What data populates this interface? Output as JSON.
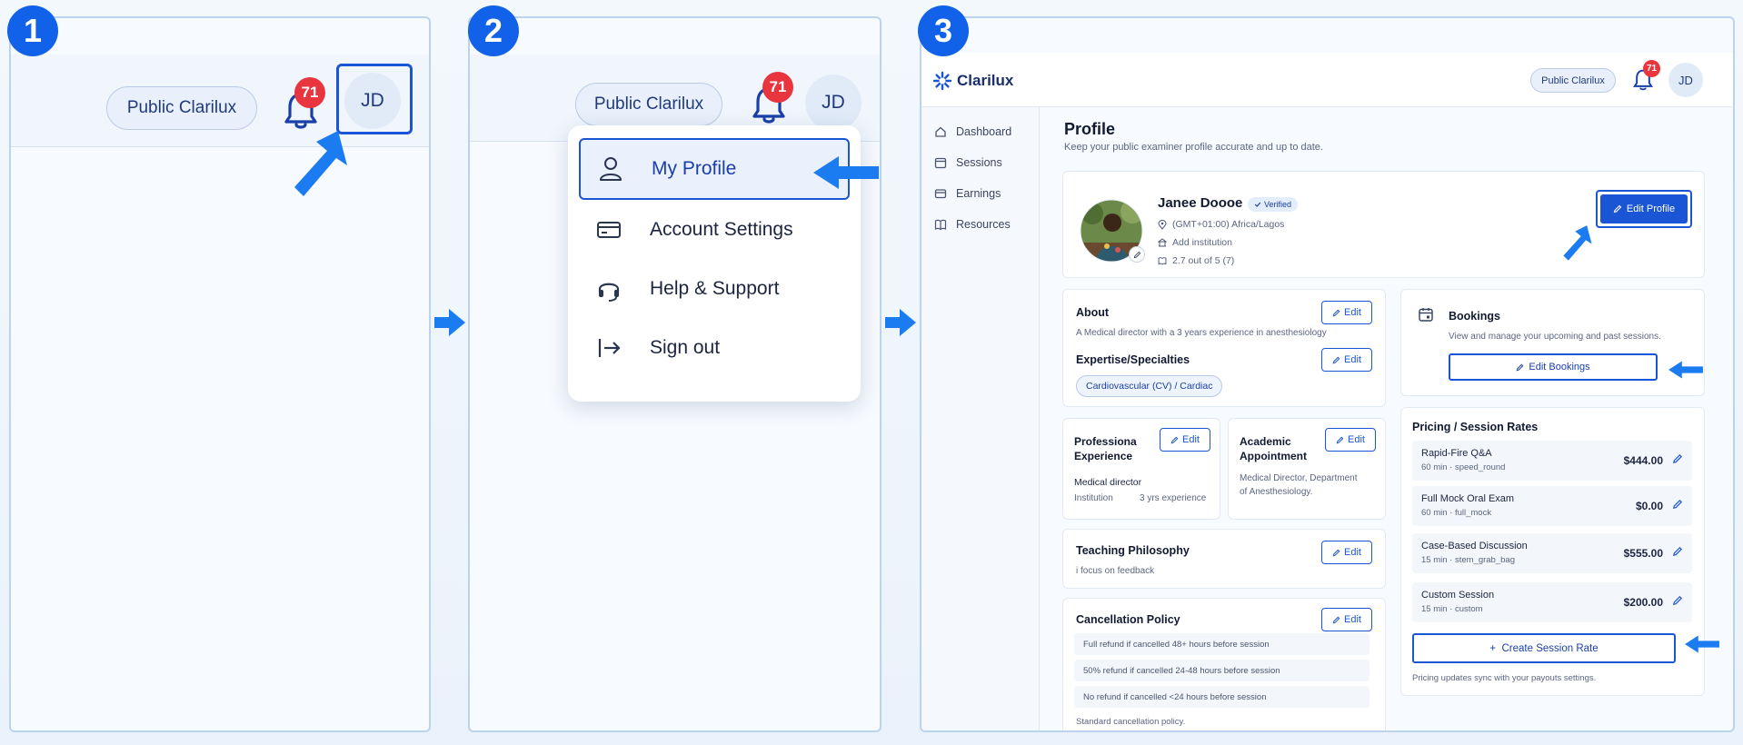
{
  "steps": [
    "1",
    "2",
    "3"
  ],
  "header": {
    "public_button": "Public Clarilux",
    "notification_count": "71",
    "avatar_initials": "JD"
  },
  "menu": {
    "items": [
      {
        "label": "My Profile",
        "icon": "user-icon"
      },
      {
        "label": "Account Settings",
        "icon": "card-icon"
      },
      {
        "label": "Help & Support",
        "icon": "headset-icon"
      },
      {
        "label": "Sign out",
        "icon": "sign-out-icon"
      }
    ]
  },
  "app": {
    "brand": "Clarilux",
    "public_button": "Public Clarilux",
    "notification_count": "71",
    "avatar_initials": "JD",
    "sidebar": [
      {
        "label": "Dashboard",
        "icon": "home-icon"
      },
      {
        "label": "Sessions",
        "icon": "calendar-icon"
      },
      {
        "label": "Earnings",
        "icon": "wallet-icon"
      },
      {
        "label": "Resources",
        "icon": "book-icon"
      }
    ],
    "page_title": "Profile",
    "page_subtitle": "Keep your public examiner profile accurate and up to date.",
    "profile": {
      "name": "Janee Doooe",
      "verified": "Verified",
      "timezone": "(GMT+01:00) Africa/Lagos",
      "institution": "Add institution",
      "rating": "2.7 out of 5 (7)",
      "edit_profile": "Edit Profile"
    },
    "edit_label": "Edit",
    "about": {
      "title": "About",
      "text": "A Medical director with a 3 years experience in anesthesiology"
    },
    "expertise": {
      "title": "Expertise/Specialties",
      "tag": "Cardiovascular (CV) / Cardiac"
    },
    "professional": {
      "title_line1": "Professiona",
      "title_line2": "Experience",
      "role": "Medical director",
      "institution": "Institution",
      "years": "3 yrs experience"
    },
    "academic": {
      "title_line1": "Academic",
      "title_line2": "Appointment",
      "text_line1": "Medical Director, Department",
      "text_line2": "of Anesthesiology."
    },
    "teaching": {
      "title": "Teaching Philosophy",
      "text": "i focus on feedback"
    },
    "cancellation": {
      "title": "Cancellation Policy",
      "rules": [
        "Full refund if cancelled 48+ hours before session",
        "50% refund if cancelled 24-48 hours before session",
        "No refund if cancelled <24 hours before session"
      ],
      "footer": "Standard cancellation policy."
    },
    "bookings": {
      "title": "Bookings",
      "text": "View and manage your upcoming and past sessions.",
      "button": "Edit Bookings"
    },
    "pricing": {
      "title": "Pricing / Session Rates",
      "rates": [
        {
          "name": "Rapid-Fire Q&A",
          "meta": "60 min · speed_round",
          "price": "$444.00"
        },
        {
          "name": "Full Mock Oral Exam",
          "meta": "60 min · full_mock",
          "price": "$0.00"
        },
        {
          "name": "Case-Based Discussion",
          "meta": "15 min · stem_grab_bag",
          "price": "$555.00"
        },
        {
          "name": "Custom Session",
          "meta": "15 min · custom",
          "price": "$200.00"
        }
      ],
      "create_button": "+  Create Session Rate",
      "footer": "Pricing updates sync with your payouts settings."
    }
  },
  "colors": {
    "accent": "#1a55d6",
    "badge": "#e8353e",
    "arrow": "#1a7cf0",
    "step_badge": "#1162e8"
  }
}
